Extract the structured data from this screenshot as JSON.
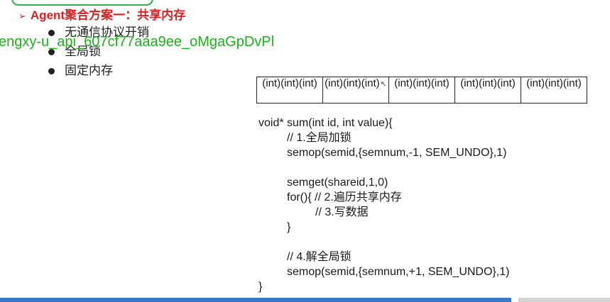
{
  "title": {
    "arrow": "➢",
    "text": "Agent聚合方案一：共享内存"
  },
  "bullets": [
    "无通信协议开销",
    "全局锁",
    "固定内存"
  ],
  "watermark": "engxy-u_api_607cf77aaa9ee_oMgaGpDvPl",
  "table": {
    "cells": [
      "(int)(int)(int)",
      "(int)(int)(int)",
      "(int)(int)(int)",
      "(int)(int)(int)",
      "(int)(int)(int)"
    ],
    "cursor_icon": "arrow-cursor-icon"
  },
  "code": {
    "l1": "void* sum(int id, int value){",
    "l2": "// 1.全局加锁",
    "l3": "semop(semid,{semnum,-1, SEM_UNDO},1)",
    "l4": "semget(shareid,1,0)",
    "l5": "for(){ // 2.遍历共享内存",
    "l6": "// 3.写数据",
    "l7": "}",
    "l8": "// 4.解全局锁",
    "l9": "semop(semid,{semnum,+1, SEM_UNDO},1)",
    "l10": "}"
  },
  "colors": {
    "title": "#e02020",
    "watermark": "#18b418",
    "progress": "#3a79c9",
    "pill_border": "#2db34a"
  }
}
